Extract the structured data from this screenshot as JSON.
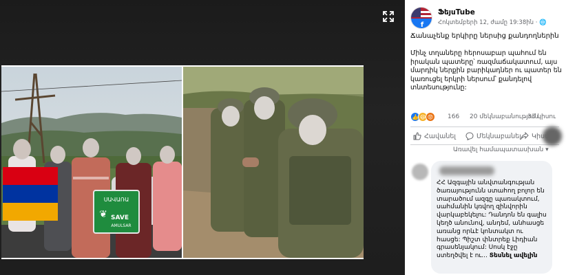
{
  "post": {
    "page_name": "ՖեյսTube",
    "time": "Հոկտեմբերի 12, ժամը 19:38ին · ",
    "title": "Ճանաչենք երկիրը ներսից քանդողներին",
    "body": "Մինչ տղաները հերոսաբար պահում են իրական պատերը՝ ռազմաճակատում, այս մարդիկ ներքին բարիկադներ ու պատեր են կառուցել երկրի ներսում՝ քանդելով տնտեսությունը:"
  },
  "reactions": {
    "count": "166",
    "comments": "20 մեկնաբանություն",
    "shares": "33 կիսու"
  },
  "actions": {
    "like": "Հավանել",
    "comment": "Մեկնաբանել",
    "share": "Կիսվել"
  },
  "comments_filter": "Առավել համապատասխան",
  "comment": {
    "text": "ՀՀ Ազգային անվտանգության ծառայությունն ստահող բոլոր են տարածում ազգը պառակտում, սահմանին կռվող զինվորին վարկաբեկելու: Դանդոն են գալիս կեղծ անունով, անդեմ, անհասցե առանց որևէ կոնտակտ ու հասցե: Պիշտ փնտրեք Լիդիան գրասենյակում: Սոսկ էջը ստեղծվել է ու...",
    "more": "Տեսնել ավելին"
  },
  "protest_sign": {
    "line1": "ՍԱՎԱՌԱ",
    "line2": "SAVE",
    "line3": "AMULSAR"
  },
  "colors": {
    "fb_blue": "#1877f2",
    "armenian_red": "#d90012",
    "armenian_blue": "#0033a0",
    "armenian_orange": "#f2a800",
    "sign_green": "#1f8c3e"
  }
}
